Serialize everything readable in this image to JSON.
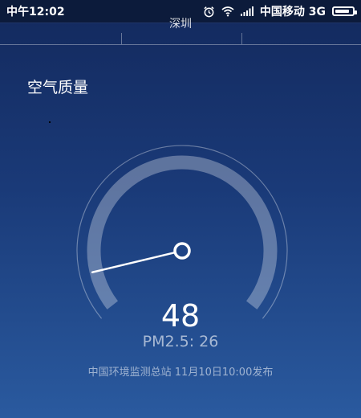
{
  "status_bar": {
    "time": "中午12:02",
    "carrier": "中国移动",
    "network": "3G",
    "battery_level": 0.85,
    "icons": [
      "alarm-icon",
      "wifi-icon",
      "signal-icon",
      "battery-icon"
    ]
  },
  "header": {
    "city": "深圳"
  },
  "main": {
    "section_title": "空气质量",
    "aqi_value": "48",
    "aqi_numeric": 48,
    "pm25_text": "PM2.5: 26",
    "source_text": "中国环境监测总站 11月10日10:00发布"
  },
  "colors": {
    "status_bar_bg": "#0c1b3b",
    "gradient_top": "#13295d",
    "gradient_bottom": "#2a5a9f"
  }
}
